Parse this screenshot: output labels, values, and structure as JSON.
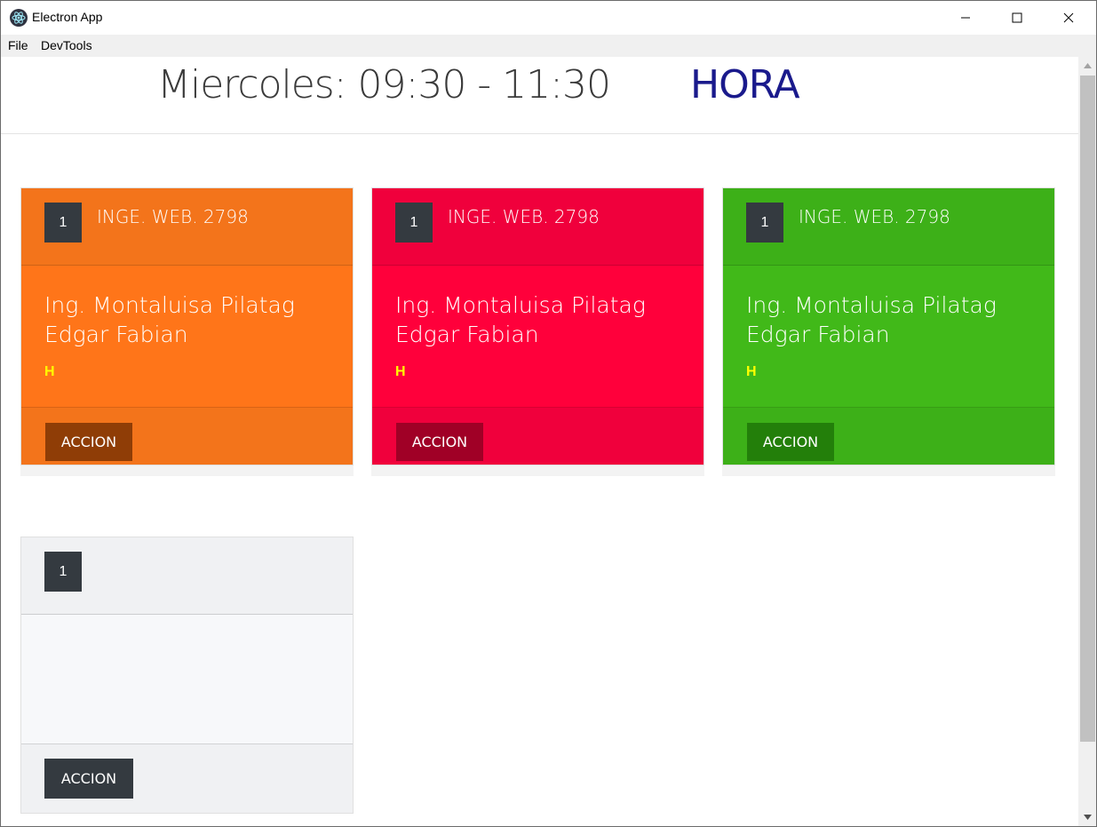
{
  "window": {
    "title": "Electron App"
  },
  "menu": {
    "file": "File",
    "devtools": "DevTools"
  },
  "header": {
    "schedule": "Miercoles: 09:30 - 11:30",
    "hora": "HORA"
  },
  "cards": [
    {
      "number": "1",
      "course": "INGE. WEB. 2798",
      "teacher": "Ing. Montaluisa Pilatag Edgar Fabian",
      "mark": "H",
      "action": "ACCION",
      "color": "#ff7519"
    },
    {
      "number": "1",
      "course": "INGE. WEB. 2798",
      "teacher": "Ing. Montaluisa Pilatag Edgar Fabian",
      "mark": "H",
      "action": "ACCION",
      "color": "#ff003b"
    },
    {
      "number": "1",
      "course": "INGE. WEB. 2798",
      "teacher": "Ing. Montaluisa Pilatag Edgar Fabian",
      "mark": "H",
      "action": "ACCION",
      "color": "#41b919"
    },
    {
      "number": "1",
      "course": "",
      "teacher": "",
      "mark": "",
      "action": "ACCION",
      "color": "#f7f8fa"
    }
  ]
}
